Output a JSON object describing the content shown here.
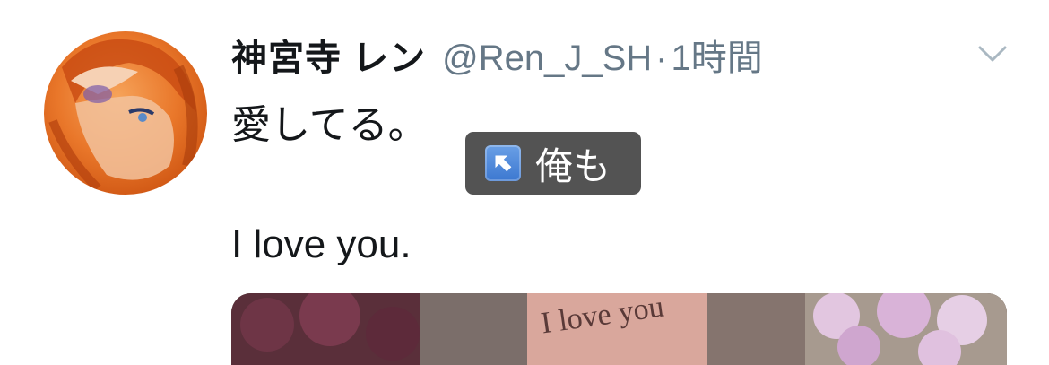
{
  "tweet": {
    "display_name": "神宮寺 レン",
    "handle": "@Ren_J_SH",
    "separator": "·",
    "time": "1時間",
    "text_jp": "愛してる。",
    "text_en": "I love you.",
    "menu_icon": "chevron-down-icon"
  },
  "overlay": {
    "icon": "up-left-arrow-icon",
    "label": "俺も"
  },
  "media": {
    "image_text": "I love you"
  },
  "colors": {
    "text": "#14171a",
    "secondary": "#657786",
    "overlay_bg": "#464646",
    "arrow_blue": "#3c78d0",
    "avatar_orange": "#e9772a"
  }
}
